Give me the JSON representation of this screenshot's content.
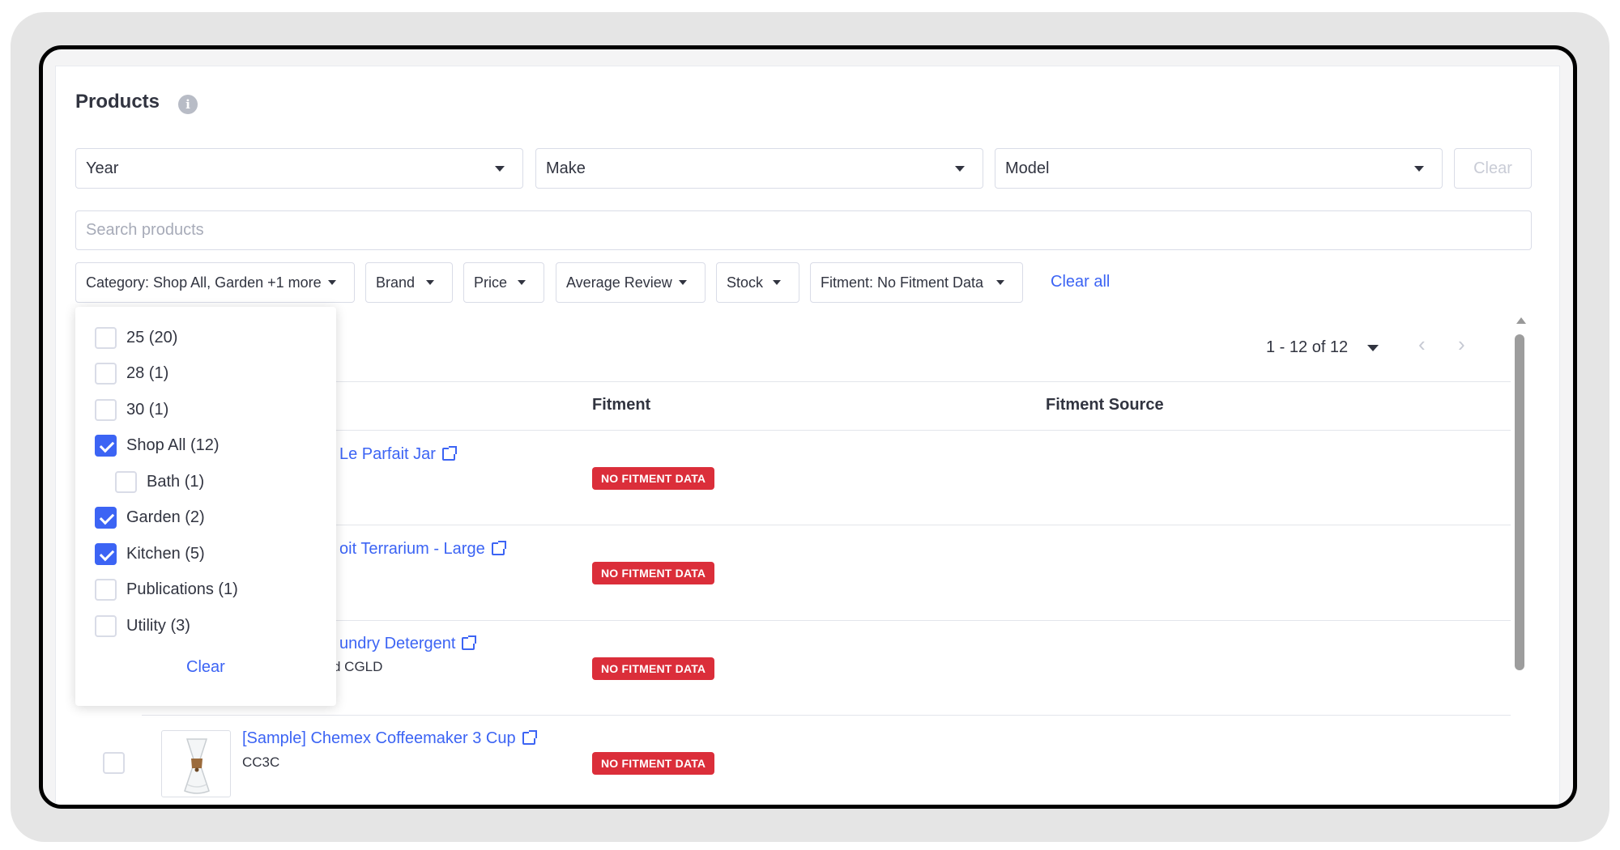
{
  "header": {
    "title": "Products"
  },
  "vehicle": {
    "year": "Year",
    "make": "Make",
    "model": "Model",
    "clear_label": "Clear"
  },
  "search": {
    "placeholder": "Search products"
  },
  "filters": {
    "category": "Category: Shop All, Garden +1 more",
    "brand": "Brand",
    "price": "Price",
    "average_review": "Average Review",
    "stock": "Stock",
    "fitment": "Fitment: No Fitment Data",
    "clear_all": "Clear all"
  },
  "pagination": {
    "range": "1 - 12 of 12"
  },
  "table": {
    "columns": [
      "Fitment",
      "Fitment Source"
    ],
    "rows": [
      {
        "name": "Le Parfait Jar",
        "sku": "",
        "fitment": "NO FITMENT DATA"
      },
      {
        "name": "oit Terrarium - Large",
        "sku": "",
        "fitment": "NO FITMENT DATA"
      },
      {
        "name": "undry Detergent",
        "sku": "d  CGLD",
        "fitment": "NO FITMENT DATA"
      },
      {
        "name": "[Sample] Chemex Coffeemaker 3 Cup",
        "sku": "CC3C",
        "fitment": "NO FITMENT DATA"
      }
    ]
  },
  "category_dropdown": {
    "options": [
      {
        "label": "25 (20)",
        "checked": false
      },
      {
        "label": "28 (1)",
        "checked": false
      },
      {
        "label": "30 (1)",
        "checked": false
      },
      {
        "label": "Shop All (12)",
        "checked": true
      },
      {
        "label": "Bath (1)",
        "checked": false
      },
      {
        "label": "Garden (2)",
        "checked": true
      },
      {
        "label": "Kitchen (5)",
        "checked": true
      },
      {
        "label": "Publications (1)",
        "checked": false
      },
      {
        "label": "Utility (3)",
        "checked": false
      }
    ],
    "clear_label": "Clear"
  },
  "colors": {
    "accent": "#3c64f4",
    "badge": "#db2e3a"
  }
}
